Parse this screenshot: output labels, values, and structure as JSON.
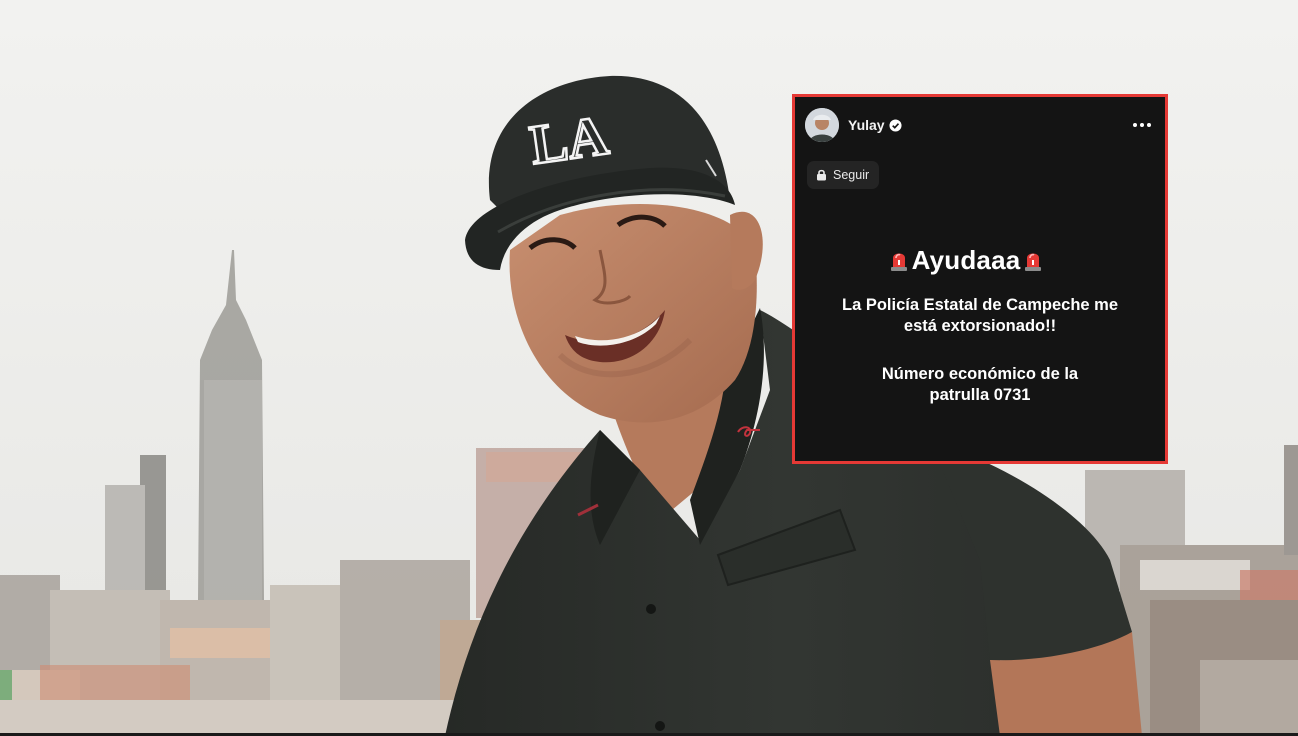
{
  "post": {
    "username": "Yulay",
    "follow_label": "Seguir",
    "headline": "Ayudaaa",
    "message_1_line_1": "La Policía Estatal de Campeche me",
    "message_1_line_2": "está extorsionado!!",
    "message_2_line_1": "Número económico de la",
    "message_2_line_2": "patrulla 0731"
  },
  "icons": {
    "verified": "verified-badge-icon",
    "more": "more-options-icon",
    "lock": "lock-icon",
    "siren": "police-siren-icon"
  },
  "colors": {
    "card_border": "#e53935",
    "card_background": "#141414",
    "shirt": "#2b2e2b",
    "cap": "#2a2d2b",
    "sky": "#efefed"
  },
  "cap_logo": "LA"
}
